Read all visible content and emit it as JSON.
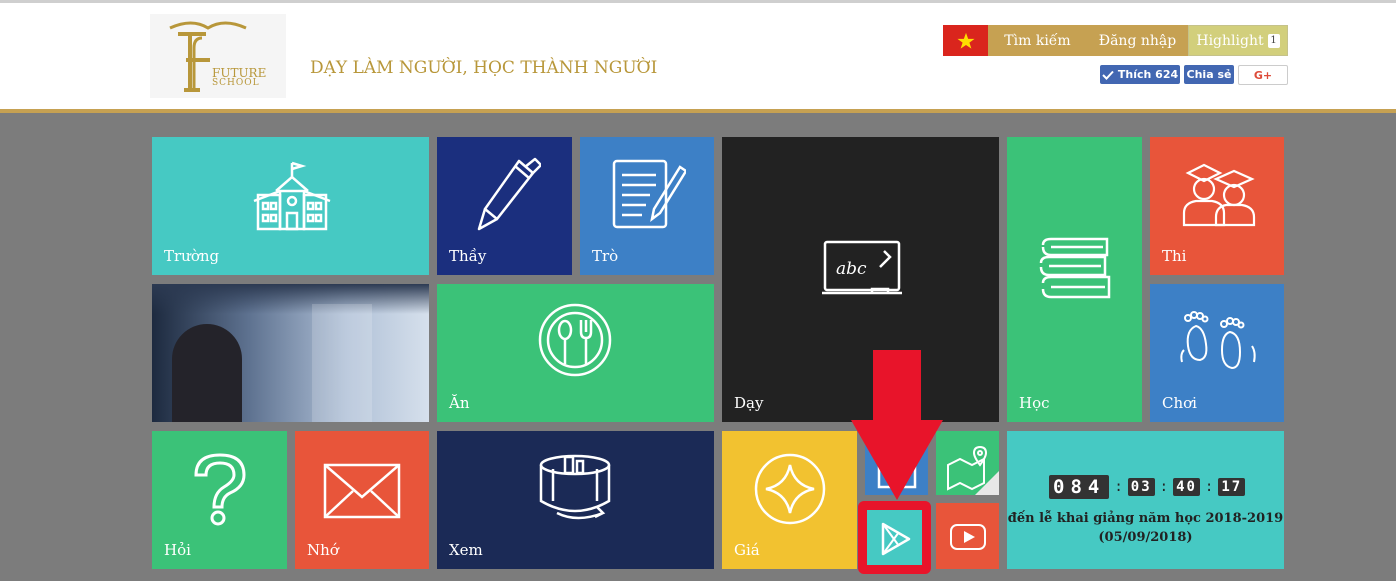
{
  "header": {
    "logo_line1": "FUTURE",
    "logo_line2": "SCHOOL",
    "tagline": "DẠY LÀM NGƯỜI, HỌC THÀNH NGƯỜI",
    "search_label": "Tìm kiếm",
    "login_label": "Đăng nhập",
    "highlight_label": "Highlight",
    "highlight_count": "1",
    "like_label": "Thích 624",
    "share_label": "Chia sẻ",
    "gplus_label": "G+"
  },
  "tiles": {
    "truong": "Trường",
    "thay": "Thầy",
    "tro": "Trò",
    "day": "Dạy",
    "hoc": "Học",
    "thi": "Thi",
    "an": "Ăn",
    "choi": "Chơi",
    "hoi": "Hỏi",
    "nho": "Nhớ",
    "xem": "Xem",
    "gia": "Giá"
  },
  "countdown": {
    "days": "084",
    "hours": "03",
    "minutes": "40",
    "seconds": "17",
    "caption_line1": "đến lễ khai giảng năm học 2018-2019",
    "caption_line2": "(05/09/2018)"
  },
  "colors": {
    "gold": "#c6a152",
    "teal": "#46c9c3",
    "navy": "#1b2f7e",
    "blue": "#3d80c6",
    "green": "#3bc278",
    "orange": "#e8553a",
    "dark": "#222222",
    "yellow": "#f2c230",
    "arrow_red": "#e8142a"
  }
}
